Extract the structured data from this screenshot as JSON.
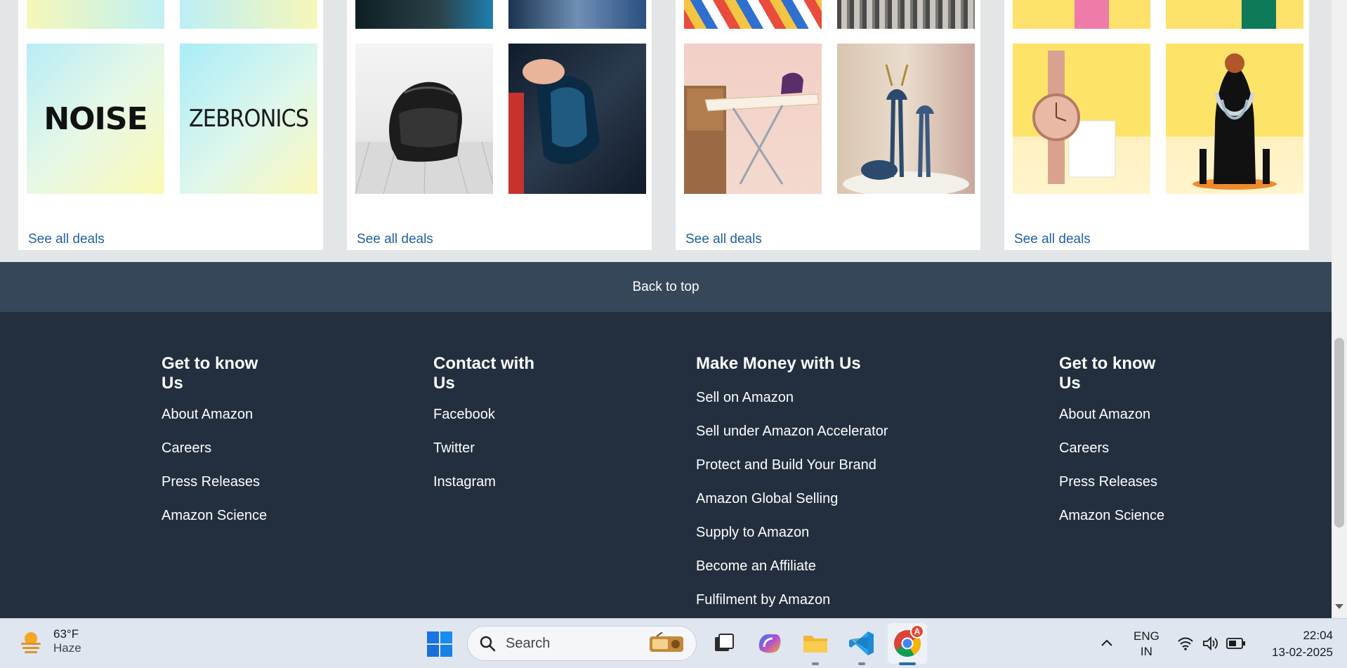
{
  "deal_cards": [
    {
      "id": "audio-brands",
      "link": "See all deals",
      "tiles": [
        "NOISE",
        "ZEBRONICS"
      ]
    },
    {
      "id": "automotive",
      "link": "See all deals"
    },
    {
      "id": "home-decor",
      "link": "See all deals"
    },
    {
      "id": "fashion-accessories",
      "link": "See all deals"
    }
  ],
  "back_to_top": "Back to top",
  "footer": {
    "columns": [
      {
        "heading_line1": "Get to know",
        "heading_line2": "Us",
        "links": [
          "About Amazon",
          "Careers",
          "Press Releases",
          "Amazon Science"
        ]
      },
      {
        "heading_line1": "Contact with",
        "heading_line2": "Us",
        "links": [
          "Facebook",
          "Twitter",
          "Instagram"
        ]
      },
      {
        "heading_line1": "Make Money with Us",
        "heading_line2": "",
        "links": [
          "Sell on Amazon",
          "Sell under Amazon Accelerator",
          "Protect and Build Your Brand",
          "Amazon Global Selling",
          "Supply to Amazon",
          "Become an Affiliate",
          "Fulfilment by Amazon"
        ]
      },
      {
        "heading_line1": "Get to know",
        "heading_line2": "Us",
        "links": [
          "About Amazon",
          "Careers",
          "Press Releases",
          "Amazon Science"
        ]
      }
    ]
  },
  "taskbar": {
    "weather": {
      "temp": "63°F",
      "desc": "Haze"
    },
    "search_label": "Search",
    "lang_line1": "ENG",
    "lang_line2": "IN",
    "time": "22:04",
    "date": "13-02-2025",
    "chrome_badge": "A",
    "icons": [
      "windows-start-icon",
      "search-icon",
      "task-view-icon",
      "copilot-icon",
      "file-explorer-icon",
      "vscode-icon",
      "chrome-icon",
      "chevron-up-icon",
      "wifi-icon",
      "speaker-icon",
      "battery-icon"
    ]
  },
  "colors": {
    "link_blue": "#2162a1",
    "back_to_top_bg": "#37475a",
    "footer_bg": "#232f3e",
    "page_bg": "#e3e6e6"
  }
}
